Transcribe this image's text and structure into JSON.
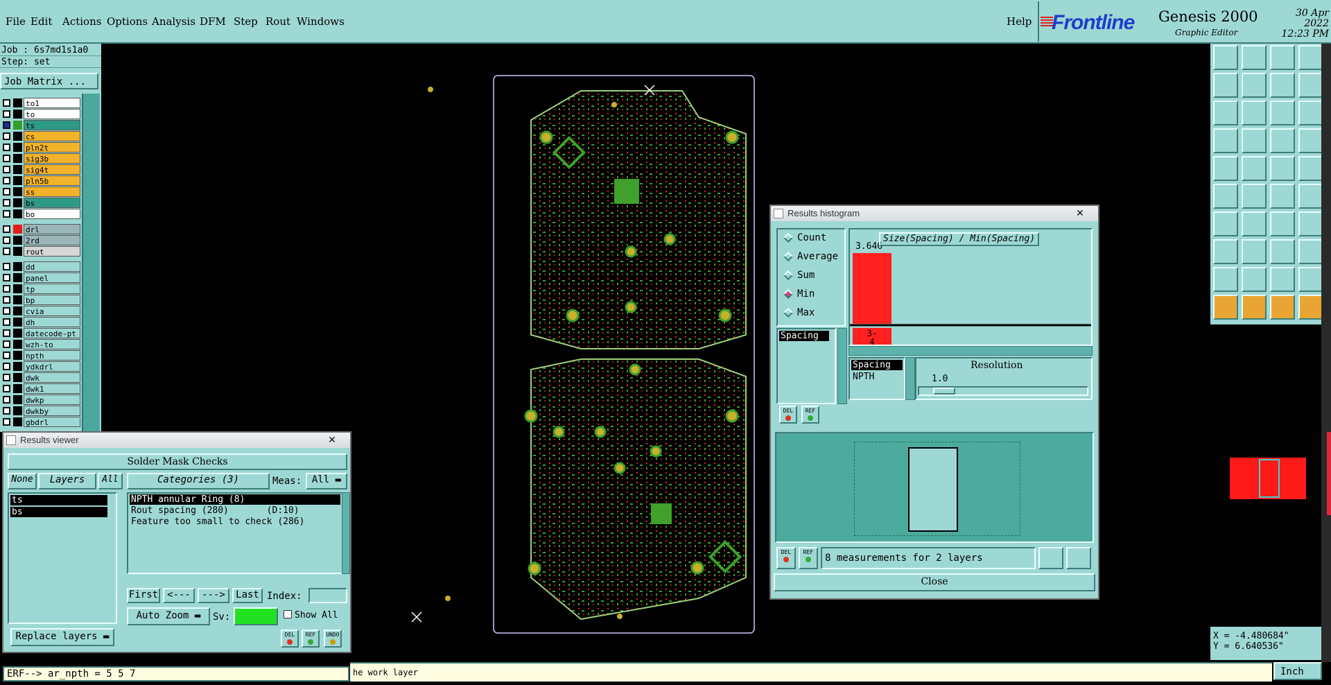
{
  "menubar": {
    "items": [
      "File",
      "Edit",
      "Actions",
      "Options",
      "Analysis",
      "DFM",
      "Step",
      "Rout",
      "Windows"
    ],
    "help": "Help"
  },
  "brand": {
    "logo": "Frontline",
    "product": "Genesis 2000",
    "subtitle": "Graphic Editor",
    "date": "30 Apr 2022",
    "time": "12:23 PM"
  },
  "job": {
    "job_line": "Job : 6s7md1s1a0",
    "step_line": "Step: set",
    "matrix_button": "Job Matrix ..."
  },
  "layers": [
    {
      "name": "to1",
      "bg": "#ffffff",
      "swatch": "#000000"
    },
    {
      "name": "to",
      "bg": "#ffffff",
      "swatch": "#000000"
    },
    {
      "name": "ts",
      "bg": "#2e9a86",
      "swatch": "#2e9e2e",
      "active": true
    },
    {
      "name": "cs",
      "bg": "#f2b22a",
      "swatch": "#000000"
    },
    {
      "name": "pln2t",
      "bg": "#f2b22a",
      "swatch": "#000000"
    },
    {
      "name": "sig3b",
      "bg": "#f2b22a",
      "swatch": "#000000"
    },
    {
      "name": "sig4t",
      "bg": "#f2b22a",
      "swatch": "#000000"
    },
    {
      "name": "pln5b",
      "bg": "#f2b22a",
      "swatch": "#000000"
    },
    {
      "name": "ss",
      "bg": "#f2b22a",
      "swatch": "#000000"
    },
    {
      "name": "bs",
      "bg": "#2e9a86",
      "swatch": "#000000"
    },
    {
      "name": "bo",
      "bg": "#ffffff",
      "swatch": "#000000"
    },
    {
      "name": "drl",
      "bg": "#9ab6b8",
      "swatch": "#e51c1c",
      "gap": true
    },
    {
      "name": "2rd",
      "bg": "#9ab6b8",
      "swatch": "#000000"
    },
    {
      "name": "rout",
      "bg": "#d6d6d6",
      "swatch": "#000000"
    },
    {
      "name": "dd",
      "bg": "#9ed8d4",
      "swatch": "#000000",
      "gap": true
    },
    {
      "name": "panel",
      "bg": "#9ed8d4",
      "swatch": "#000000"
    },
    {
      "name": "tp",
      "bg": "#9ed8d4",
      "swatch": "#000000"
    },
    {
      "name": "bp",
      "bg": "#9ed8d4",
      "swatch": "#000000"
    },
    {
      "name": "cvia",
      "bg": "#9ed8d4",
      "swatch": "#000000"
    },
    {
      "name": "dh",
      "bg": "#9ed8d4",
      "swatch": "#000000"
    },
    {
      "name": "datecode-pt",
      "bg": "#9ed8d4",
      "swatch": "#000000"
    },
    {
      "name": "wzh-to",
      "bg": "#9ed8d4",
      "swatch": "#000000"
    },
    {
      "name": "npth",
      "bg": "#9ed8d4",
      "swatch": "#000000"
    },
    {
      "name": "ydkdrl",
      "bg": "#9ed8d4",
      "swatch": "#000000"
    },
    {
      "name": "dwk",
      "bg": "#9ed8d4",
      "swatch": "#000000"
    },
    {
      "name": "dwk1",
      "bg": "#9ed8d4",
      "swatch": "#000000"
    },
    {
      "name": "dwkp",
      "bg": "#9ed8d4",
      "swatch": "#000000"
    },
    {
      "name": "dwkby",
      "bg": "#9ed8d4",
      "swatch": "#000000"
    },
    {
      "name": "gbdrl",
      "bg": "#9ed8d4",
      "swatch": "#000000"
    }
  ],
  "histogram": {
    "title": "Results histogram",
    "close_x": "✕",
    "modes": [
      {
        "label": "Count",
        "on": false
      },
      {
        "label": "Average",
        "on": false
      },
      {
        "label": "Sum",
        "on": false
      },
      {
        "label": "Min",
        "on": true
      },
      {
        "label": "Max",
        "on": false
      }
    ],
    "list_item": "Spacing",
    "chart_title": "Size(Spacing) / Min(Spacing)",
    "bar_value_label": "3.646",
    "bar_value": 3.646,
    "bar_category": "3-\n4",
    "bar_color": "#ff2020",
    "selection_list": [
      "Spacing",
      "NPTH"
    ],
    "resolution_label": "Resolution",
    "resolution_value": "1.0",
    "summary": "8 measurements for 2 layers",
    "close_button": "Close",
    "del_label": "DEL",
    "ref_label": "REF"
  },
  "viewer": {
    "title": "Results viewer",
    "close_x": "✕",
    "header": "Solder Mask Checks",
    "none_btn": "None",
    "layers_btn": "Layers",
    "all_btn": "All",
    "categories_label": "Categories (3)",
    "meas_label": "Meas:",
    "meas_value": "All",
    "layer_list": [
      "ts",
      "bs"
    ],
    "categories": [
      {
        "text": "NPTH annular Ring (8)",
        "selected": true
      },
      {
        "text": "Rout spacing (280)       (D:10)",
        "selected": false
      },
      {
        "text": "Feature too small to check (286)",
        "selected": false
      }
    ],
    "first_btn": "First",
    "prev_btn": "<---",
    "next_btn": "--->",
    "last_btn": "Last",
    "index_label": "Index:",
    "auto_zoom": "Auto Zoom",
    "sv_label": "Sv:",
    "show_all": "Show All",
    "replace_layers": "Replace layers",
    "undo_label": "UNDO"
  },
  "status": {
    "command": "ERF--> ar_npth = 5 5 7",
    "work_layer": "he work layer",
    "coord_x": "X = -4.480684\"",
    "coord_y": "Y =  6.640536\"",
    "units": "Inch"
  }
}
